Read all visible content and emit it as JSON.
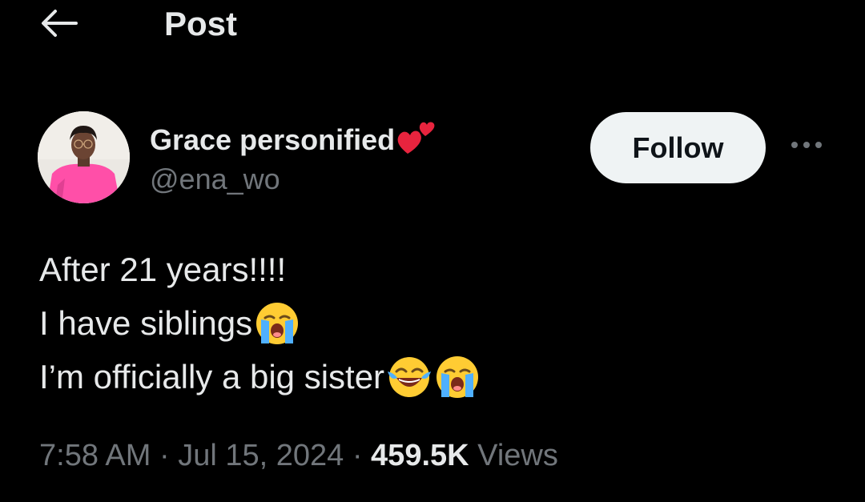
{
  "header": {
    "title": "Post"
  },
  "author": {
    "display_name": "Grace personified",
    "name_emoji": "two-hearts-icon",
    "handle": "@ena_wo"
  },
  "actions": {
    "follow_label": "Follow",
    "more_icon": "more-horizontal-icon"
  },
  "tweet": {
    "lines": [
      "After 21 years!!!!",
      "I have siblings",
      "I’m officially a big sister"
    ],
    "line_emojis": [
      [],
      [
        "loudly-crying-face-icon"
      ],
      [
        "face-with-tears-of-joy-icon",
        "loudly-crying-face-icon"
      ]
    ]
  },
  "meta": {
    "time": "7:58 AM",
    "separator": "·",
    "date": "Jul 15, 2024",
    "views_count": "459.5K",
    "views_label": "Views"
  },
  "colors": {
    "background": "#000000",
    "primary_text": "#e7e9ea",
    "secondary_text": "#71767b",
    "follow_button_bg": "#eff3f4",
    "follow_button_text": "#0f1419"
  }
}
